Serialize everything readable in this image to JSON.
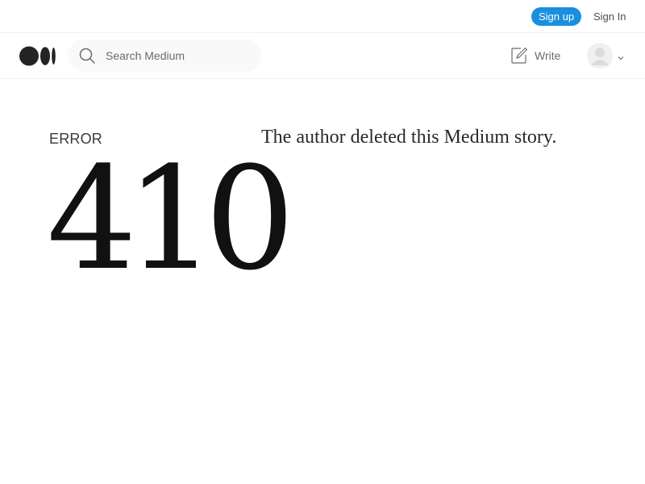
{
  "topbar": {
    "signup_label": "Sign up",
    "signin_label": "Sign In"
  },
  "navbar": {
    "logo_icon": "medium-logo-icon",
    "search": {
      "placeholder": "Search Medium",
      "value": "",
      "icon": "search-icon"
    },
    "write_label": "Write",
    "write_icon": "write-icon",
    "avatar_icon": "avatar-icon",
    "menu_icon": "chevron-down-icon"
  },
  "error_page": {
    "label": "ERROR",
    "code": "410",
    "message": "The author deleted this Medium story."
  },
  "colors": {
    "signup_button": "#1a8fdf",
    "text": "#242424",
    "search_background": "#f9f9f9"
  }
}
